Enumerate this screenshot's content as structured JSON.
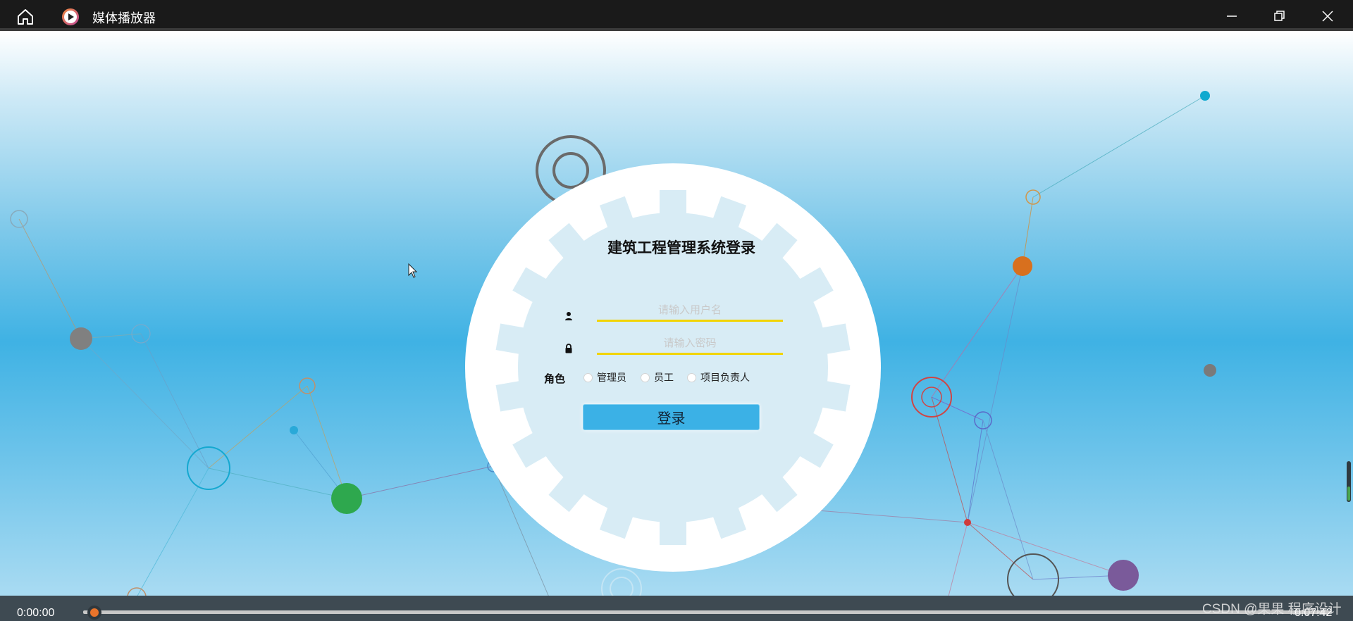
{
  "window": {
    "title": "媒体播放器",
    "controls": {
      "minimize_icon": "minimize-icon",
      "maximize_icon": "restore-icon",
      "close_icon": "close-icon"
    }
  },
  "video": {
    "login_form": {
      "title": "建筑工程管理系统登录",
      "username_placeholder": "请输入用户名",
      "password_placeholder": "请输入密码",
      "role_label": "角色",
      "roles": [
        "管理员",
        "员工",
        "项目负责人"
      ],
      "submit_label": "登录"
    },
    "watermark": "CSDN @果果 程序设计"
  },
  "player": {
    "current_time": "0:00:00",
    "total_time": "0:07:42",
    "progress": 0.0,
    "volume": 0.35
  },
  "colors": {
    "accent": "#e9742b",
    "field_underline": "#f2d400",
    "button": "#3bb1e6",
    "titlebar": "#1a1a1a",
    "controls": "#3e4a52"
  }
}
